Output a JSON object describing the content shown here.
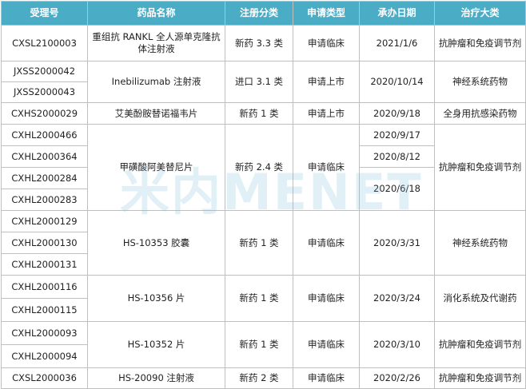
{
  "headers": [
    "受理号",
    "药品名称",
    "注册分类",
    "申请类型",
    "承办日期",
    "治疗大类"
  ],
  "groups": [
    {
      "accept_nos": [
        "CXSL2100003"
      ],
      "drug": "重组抗 RANKL 全人源单克隆抗体注射液",
      "category": "新药 3.3 类",
      "app_type": "申请临床",
      "dates": [
        "2021/1/6"
      ],
      "therapy": "抗肿瘤和免疫调节剂"
    },
    {
      "accept_nos": [
        "JXSS2000042",
        "JXSS2000043"
      ],
      "drug": "Inebilizumab 注射液",
      "category": "进口 3.1 类",
      "app_type": "申请上市",
      "dates": [
        "2020/10/14"
      ],
      "therapy": "神经系统药物"
    },
    {
      "accept_nos": [
        "CXHS2000029"
      ],
      "drug": "艾美酚胺替诺福韦片",
      "category": "新药 1 类",
      "app_type": "申请上市",
      "dates": [
        "2020/9/18"
      ],
      "therapy": "全身用抗感染药物"
    },
    {
      "accept_nos": [
        "CXHL2000466",
        "CXHL2000364",
        "CXHL2000284",
        "CXHL2000283"
      ],
      "drug": "甲磺酸阿美替尼片",
      "category": "新药 2.4 类",
      "app_type": "申请临床",
      "dates": [
        "2020/9/17",
        "2020/8/12",
        "2020/6/18"
      ],
      "therapy": "抗肿瘤和免疫调节剂"
    },
    {
      "accept_nos": [
        "CXHL2000129",
        "CXHL2000130",
        "CXHL2000131"
      ],
      "drug": "HS-10353 胶囊",
      "category": "新药 1 类",
      "app_type": "申请临床",
      "dates": [
        "2020/3/31"
      ],
      "therapy": "神经系统药物"
    },
    {
      "accept_nos": [
        "CXHL2000116",
        "CXHL2000115"
      ],
      "drug": "HS-10356 片",
      "category": "新药 1 类",
      "app_type": "申请临床",
      "dates": [
        "2020/3/24"
      ],
      "therapy": "消化系统及代谢药"
    },
    {
      "accept_nos": [
        "CXHL2000093",
        "CXHL2000094"
      ],
      "drug": "HS-10352 片",
      "category": "新药 1 类",
      "app_type": "申请临床",
      "dates": [
        "2020/3/10"
      ],
      "therapy": "抗肿瘤和免疫调节剂"
    },
    {
      "accept_nos": [
        "CXSL2000036"
      ],
      "drug": "HS-20090 注射液",
      "category": "新药 2 类",
      "app_type": "申请临床",
      "dates": [
        "2020/2/26"
      ],
      "therapy": "抗肿瘤和免疫调节剂"
    }
  ],
  "watermark": "米内MENET"
}
